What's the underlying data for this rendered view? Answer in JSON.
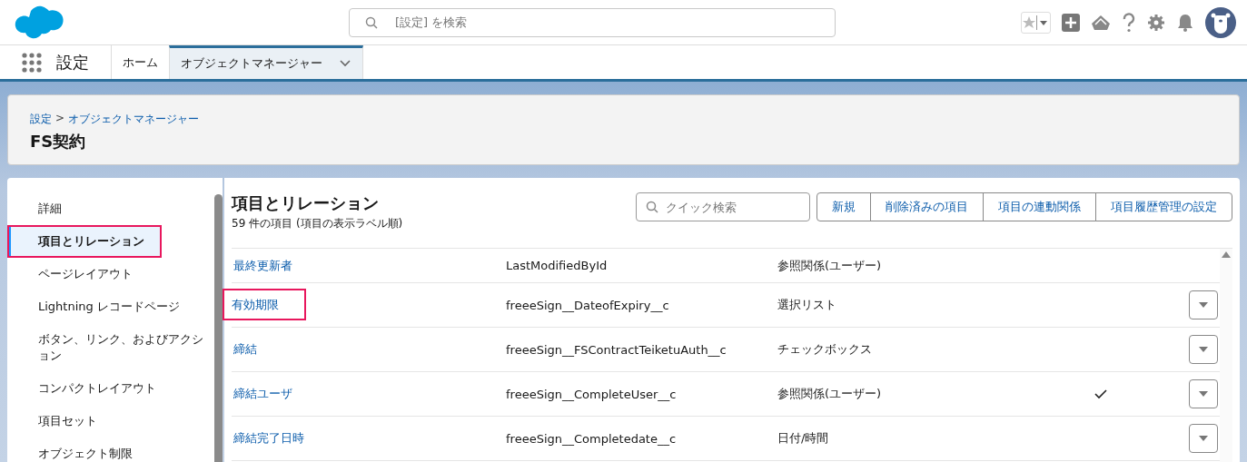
{
  "header": {
    "search": {
      "placeholder": "[設定] を検索"
    }
  },
  "nav": {
    "app_name": "設定",
    "tabs": [
      {
        "label": "ホーム",
        "selected": false,
        "has_menu": false
      },
      {
        "label": "オブジェクトマネージャー",
        "selected": true,
        "has_menu": true
      }
    ]
  },
  "page_header": {
    "breadcrumbs": [
      {
        "label": "設定"
      },
      {
        "label": "オブジェクトマネージャー"
      }
    ],
    "breadcrumb_separator": ">",
    "title": "FS契約"
  },
  "sidebar": {
    "items": [
      {
        "label": "詳細",
        "selected": false,
        "highlighted": false
      },
      {
        "label": "項目とリレーション",
        "selected": true,
        "highlighted": true
      },
      {
        "label": "ページレイアウト",
        "selected": false,
        "highlighted": false
      },
      {
        "label": "Lightning レコードページ",
        "selected": false,
        "highlighted": false
      },
      {
        "label": "ボタン、リンク、およびアクション",
        "selected": false,
        "highlighted": false
      },
      {
        "label": "コンパクトレイアウト",
        "selected": false,
        "highlighted": false
      },
      {
        "label": "項目セット",
        "selected": false,
        "highlighted": false
      },
      {
        "label": "オブジェクト制限",
        "selected": false,
        "highlighted": false
      }
    ]
  },
  "content": {
    "title": "項目とリレーション",
    "subtitle": "59 件の項目 (項目の表示ラベル順)",
    "quick_search": {
      "placeholder": "クイック検索"
    },
    "buttons": [
      "新規",
      "削除済みの項目",
      "項目の連動関係",
      "項目履歴管理の設定"
    ],
    "rows": [
      {
        "label": "最終更新者",
        "api_name": "LastModifiedById",
        "type": "参照関係(ユーザー)",
        "indexed": false,
        "has_menu": false,
        "highlighted": false
      },
      {
        "label": "有効期限",
        "api_name": "freeeSign__DateofExpiry__c",
        "type": "選択リスト",
        "indexed": false,
        "has_menu": true,
        "highlighted": true
      },
      {
        "label": "締結",
        "api_name": "freeeSign__FSContractTeiketuAuth__c",
        "type": "チェックボックス",
        "indexed": false,
        "has_menu": true,
        "highlighted": false
      },
      {
        "label": "締結ユーザ",
        "api_name": "freeeSign__CompleteUser__c",
        "type": "参照関係(ユーザー)",
        "indexed": true,
        "has_menu": true,
        "highlighted": false
      },
      {
        "label": "締結完了日時",
        "api_name": "freeeSign__Completedate__c",
        "type": "日付/時間",
        "indexed": false,
        "has_menu": true,
        "highlighted": false
      }
    ]
  }
}
